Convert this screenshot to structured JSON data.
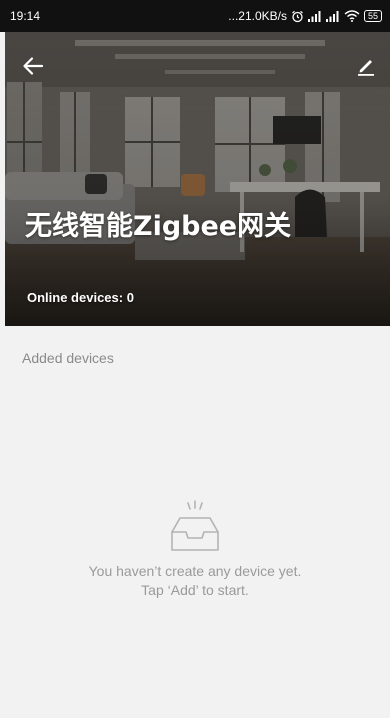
{
  "status_bar": {
    "time": "19:14",
    "network_speed": "...21.0KB/s",
    "battery": "55",
    "icons": [
      "alarm-icon",
      "signal-icon",
      "signal-icon",
      "wifi-icon",
      "battery-icon"
    ]
  },
  "header": {
    "title": "无线智能Zigbee网关",
    "online_label": "Online devices: 0",
    "back_icon": "arrow-left-icon",
    "edit_icon": "pencil-icon"
  },
  "devices_section": {
    "label": "Added devices"
  },
  "empty_state": {
    "icon": "empty-inbox-icon",
    "line1": "You haven’t create any device yet.",
    "line2": "Tap ‘Add’ to start."
  },
  "colors": {
    "background": "#f2f2f2",
    "status_bar": "#111111",
    "muted_text": "#9a9a9a"
  }
}
